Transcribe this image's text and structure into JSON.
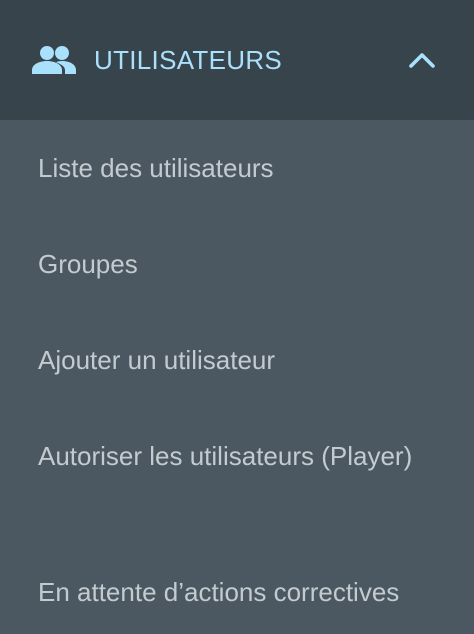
{
  "header": {
    "icon": "people-icon",
    "label": "UTILISATEURS",
    "toggle_icon": "chevron-up-icon",
    "expanded": true
  },
  "submenu": {
    "items": [
      {
        "label": "Liste des utilisateurs"
      },
      {
        "label": "Groupes"
      },
      {
        "label": "Ajouter un utilisateur"
      },
      {
        "label": "Autoriser les utilisateurs (Player)"
      },
      {
        "label": "En attente d’actions correctives"
      }
    ]
  },
  "colors": {
    "header_background": "#37444c",
    "menu_background": "#4b5861",
    "accent": "#a9e0fb",
    "item_text": "#c3cbd1"
  }
}
